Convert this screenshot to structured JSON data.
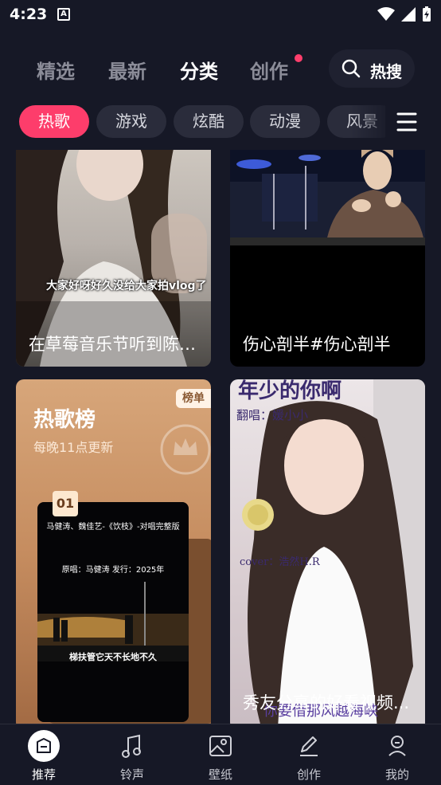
{
  "status": {
    "time": "4:23",
    "a_icon": "A"
  },
  "top_tabs": [
    {
      "label": "精选"
    },
    {
      "label": "最新"
    },
    {
      "label": "分类"
    },
    {
      "label": "创作"
    }
  ],
  "active_tab": "分类",
  "hot_search": {
    "label": "热搜",
    "icon": "search-icon"
  },
  "categories": [
    {
      "label": "热歌"
    },
    {
      "label": "游戏"
    },
    {
      "label": "炫酷"
    },
    {
      "label": "动漫"
    },
    {
      "label": "风景"
    }
  ],
  "active_category": "热歌",
  "cards": [
    {
      "title": "在草莓音乐节听到陈绮贞...",
      "overlay_text": "大家好呀好久没给大家拍vlog了"
    },
    {
      "title": "伤心剖半#伤心剖半"
    },
    {
      "title": "热歌榜",
      "subtitle": "每晚11点更新",
      "badge": "榜单",
      "rank": "01",
      "poster_line1": "马健涛、魏佳艺-《饮枝》-对唱完整版",
      "poster_line2": "原唱：马健涛    发行：2025年",
      "poster_line3": "梯扶管它天不长地不久"
    },
    {
      "title": "秀友分享的好看视频...",
      "top_text": "年少的你啊",
      "sub_text": "翻唱：媛小小",
      "cover_text": "cover：浩然H.R",
      "lyric_text": "你要借那风越海峡"
    }
  ],
  "bottom_nav": [
    {
      "label": "推荐",
      "icon": "recommend-icon"
    },
    {
      "label": "铃声",
      "icon": "music-note-icon"
    },
    {
      "label": "壁纸",
      "icon": "image-icon"
    },
    {
      "label": "创作",
      "icon": "pencil-icon"
    },
    {
      "label": "我的",
      "icon": "profile-icon"
    }
  ],
  "colors": {
    "accent": "#fd3d6b",
    "background": "#161826",
    "chip": "#2a2c3b"
  }
}
